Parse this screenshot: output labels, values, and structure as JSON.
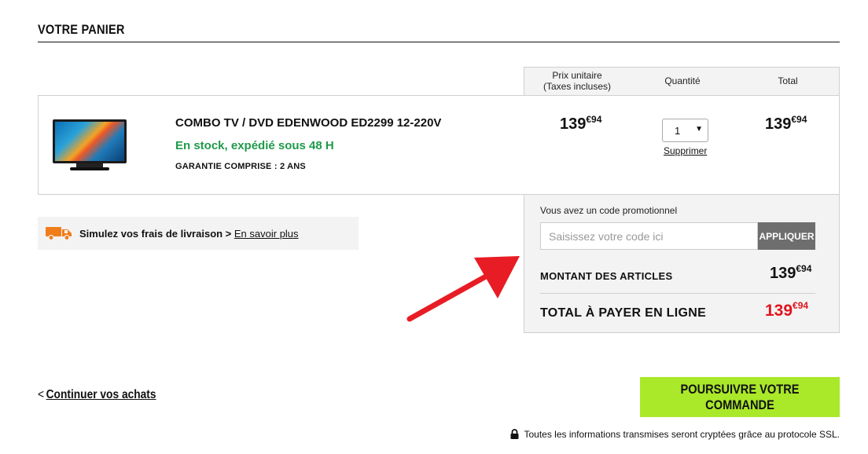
{
  "cart": {
    "title": "VOTRE PANIER",
    "columns": {
      "unit_price": "Prix unitaire\n(Taxes incluses)",
      "quantity": "Quantité",
      "total": "Total"
    },
    "item": {
      "name": "COMBO TV / DVD EDENWOOD ED2299 12-220V",
      "stock": "En stock, expédié sous 48 H",
      "warranty": "GARANTIE COMPRISE : 2 ANS",
      "unit_price_main": "139",
      "unit_price_cents": "€94",
      "quantity": "1",
      "remove_label": "Supprimer",
      "total_main": "139",
      "total_cents": "€94"
    }
  },
  "shipping": {
    "text": "Simulez vos frais de livraison > ",
    "link": "En savoir plus"
  },
  "promo": {
    "label": "Vous avez un code promotionnel",
    "placeholder": "Saisissez votre code ici",
    "apply_label": "APPLIQUER"
  },
  "totals": {
    "articles_label": "MONTANT DES ARTICLES",
    "articles_main": "139",
    "articles_cents": "€94",
    "grand_label": "TOTAL À PAYER EN LIGNE",
    "grand_main": "139",
    "grand_cents": "€94"
  },
  "footer": {
    "continue_label": "Continuer vos achats",
    "proceed_label": "POURSUIVRE VOTRE COMMANDE",
    "ssl_text": "Toutes les informations transmises seront cryptées grâce au protocole SSL."
  },
  "icons": {
    "truck": "truck-icon",
    "lock": "lock-icon",
    "chevron": "chevron-left-icon",
    "dropdown": "chevron-down-icon"
  },
  "colors": {
    "accent_green": "#aae82a",
    "stock_green": "#1f9a4a",
    "total_red": "#e1141c",
    "truck_orange": "#f07d1a",
    "arrow_red": "#e81c24"
  }
}
